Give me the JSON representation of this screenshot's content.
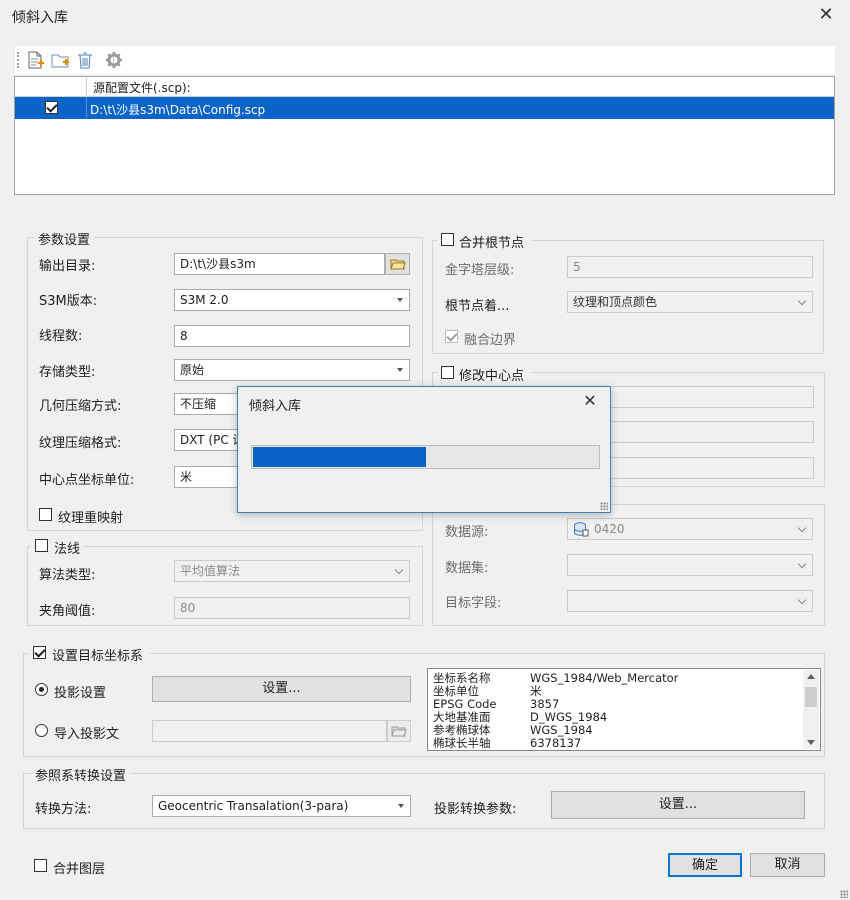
{
  "window": {
    "title": "倾斜入库"
  },
  "grid": {
    "header": "源配置文件(.scp):",
    "rows": [
      {
        "path": "D:\\t\\沙县s3m\\Data\\Config.scp",
        "checked": true
      }
    ]
  },
  "params": {
    "title": "参数设置",
    "output_dir_label": "输出目录:",
    "output_dir_value": "D:\\t\\沙县s3m",
    "s3m_label": "S3M版本:",
    "s3m_value": "S3M 2.0",
    "threads_label": "线程数:",
    "threads_value": "8",
    "storage_label": "存储类型:",
    "storage_value": "原始",
    "geo_comp_label": "几何压缩方式:",
    "geo_comp_value": "不压缩",
    "tex_comp_label": "纹理压缩格式:",
    "tex_comp_value": "DXT (PC 设",
    "center_unit_label": "中心点坐标单位:",
    "center_unit_value": "米",
    "remap_label": "纹理重映射"
  },
  "normals": {
    "title": "法线",
    "algo_label": "算法类型:",
    "algo_value": "平均值算法",
    "angle_label": "夹角阈值:",
    "angle_value": "80"
  },
  "merge_root": {
    "title": "合并根节点",
    "pyramid_label": "金字塔层级:",
    "pyramid_value": "5",
    "root_label": "根节点着...",
    "root_value": "纹理和顶点颜色",
    "fuse_label": "融合边界"
  },
  "modify_center": {
    "title": "修改中心点"
  },
  "data_source": {
    "ds_label": "数据源:",
    "ds_value": "0420",
    "dataset_label": "数据集:",
    "field_label": "目标字段:"
  },
  "target_crs": {
    "title": "设置目标坐标系",
    "proj_setting_label": "投影设置",
    "settings_button": "设置...",
    "import_label": "导入投影文",
    "info": [
      {
        "k": "坐标系名称",
        "v": "WGS_1984/Web_Mercator"
      },
      {
        "k": "坐标单位",
        "v": "米"
      },
      {
        "k": "EPSG Code",
        "v": "3857"
      },
      {
        "k": "大地基准面",
        "v": "D_WGS_1984"
      },
      {
        "k": "参考椭球体",
        "v": "WGS_1984"
      },
      {
        "k": "椭球长半轴",
        "v": "6378137"
      }
    ]
  },
  "transform": {
    "title": "参照系转换设置",
    "method_label": "转换方法:",
    "method_value": "Geocentric Transalation(3-para)",
    "params_label": "投影转换参数:",
    "params_button": "设置..."
  },
  "footer": {
    "merge_layers": "合并图层",
    "ok": "确定",
    "cancel": "取消"
  },
  "progress_dialog": {
    "title": "倾斜入库",
    "progress": 0.5
  },
  "colors": {
    "accent": "#0a64c8",
    "focus_border": "#0078d7"
  }
}
